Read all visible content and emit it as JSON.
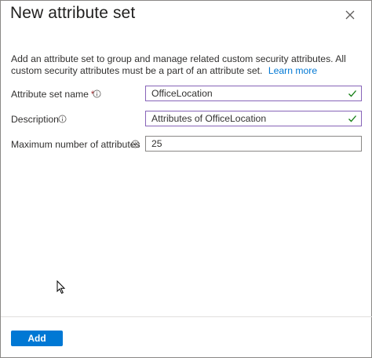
{
  "panel": {
    "title": "New attribute set",
    "description": "Add an attribute set to group and manage related custom security attributes. All custom security attributes must be a part of an attribute set.",
    "learn_more": "Learn more"
  },
  "form": {
    "name": {
      "label": "Attribute set name",
      "required_mark": "*",
      "value": "OfficeLocation",
      "status": "valid"
    },
    "description": {
      "label": "Description",
      "value": "Attributes of OfficeLocation",
      "status": "valid"
    },
    "max_attributes": {
      "label": "Maximum number of attributes",
      "value": "25"
    }
  },
  "footer": {
    "add_label": "Add"
  },
  "icons": {
    "close": "close-icon",
    "info": "info-icon",
    "check": "checkmark-icon",
    "cursor": "mouse-pointer-icon"
  },
  "colors": {
    "accent": "#0078d4",
    "valid_border": "#8764b8",
    "valid_check": "#107c10",
    "required": "#a4262c"
  }
}
